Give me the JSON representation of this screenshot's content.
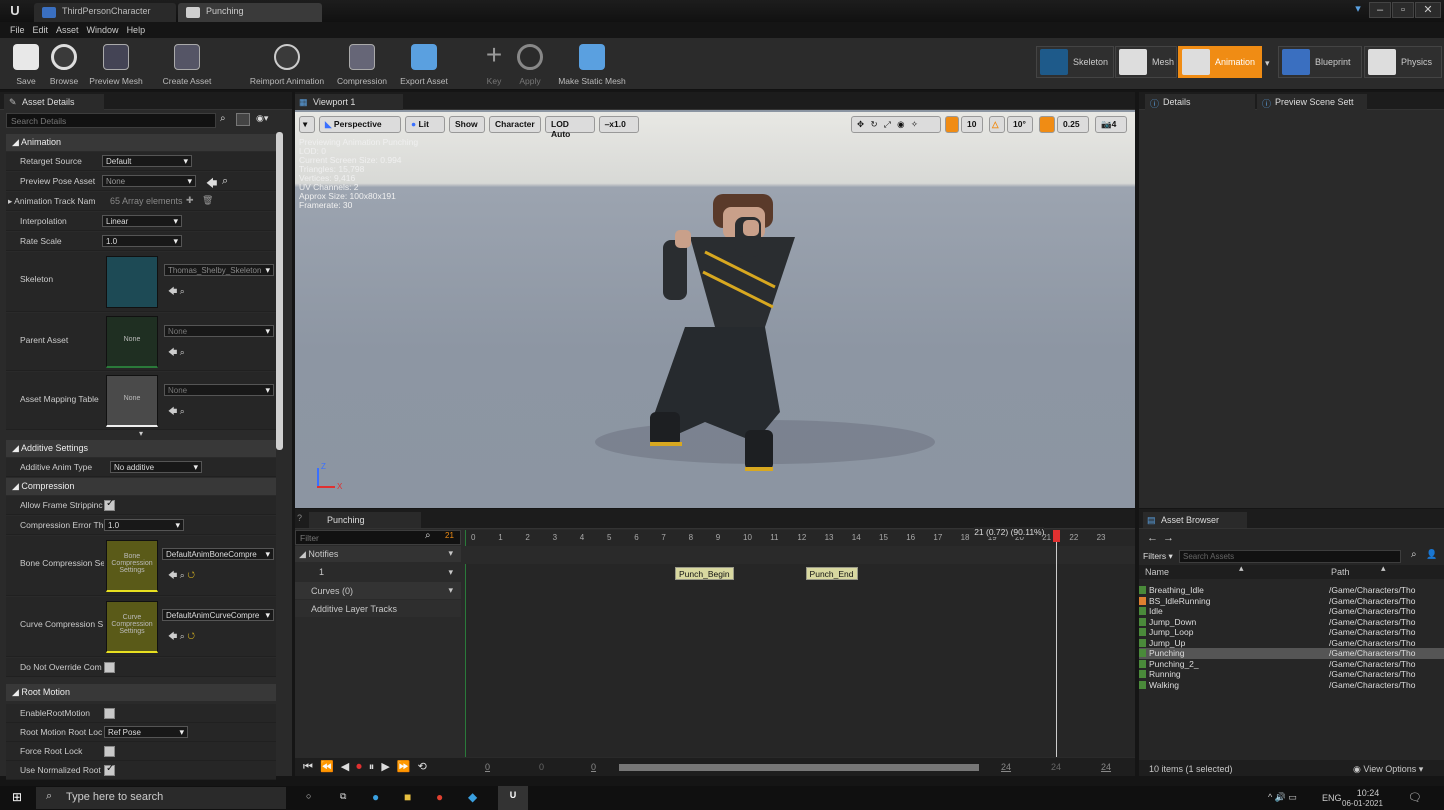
{
  "window": {
    "tabs": [
      "ThirdPersonCharacter",
      "Punching"
    ],
    "controls": [
      "▾",
      "–",
      "▫",
      "✕"
    ]
  },
  "menu": [
    "File",
    "Edit",
    "Asset",
    "Window",
    "Help"
  ],
  "toolbar": {
    "buttons": [
      "Save",
      "Browse",
      "Preview Mesh",
      "Create Asset",
      "Reimport Animation",
      "Compression",
      "Export Asset",
      "Key",
      "Apply",
      "Make Static Mesh"
    ]
  },
  "modes": [
    "Skeleton",
    "Mesh",
    "Animation",
    "Blueprint",
    "Physics"
  ],
  "colors": {
    "accent": "#f08c14",
    "panel": "#2a2a2a"
  },
  "asset_details": {
    "tab": "Asset Details",
    "search_placeholder": "Search Details",
    "categories": [
      "Animation",
      "Additive Settings",
      "Compression",
      "Root Motion"
    ],
    "rows": {
      "retarget_source": {
        "label": "Retarget Source",
        "value": "Default"
      },
      "preview_pose": {
        "label": "Preview Pose Asset",
        "value": "None"
      },
      "track_names": {
        "label": "Animation Track Nam",
        "value": "65 Array elements"
      },
      "interpolation": {
        "label": "Interpolation",
        "value": "Linear"
      },
      "rate_scale": {
        "label": "Rate Scale",
        "value": "1.0"
      },
      "skeleton": {
        "label": "Skeleton",
        "value": "Thomas_Shelby_Skeleton"
      },
      "parent_asset": {
        "label": "Parent Asset",
        "value": "None",
        "thumb": "None"
      },
      "mapping_table": {
        "label": "Asset Mapping Table",
        "value": "None",
        "thumb": "None"
      },
      "additive_type": {
        "label": "Additive Anim Type",
        "value": "No additive"
      },
      "allow_strip": {
        "label": "Allow Frame Strippinc"
      },
      "compression_error": {
        "label": "Compression Error Th",
        "value": "1.0"
      },
      "bone_compression": {
        "label": "Bone Compression Se",
        "value": "DefaultAnimBoneCompre",
        "thumb": "Bone Compression Settings"
      },
      "curve_compression": {
        "label": "Curve Compression S",
        "value": "DefaultAnimCurveCompre",
        "thumb": "Curve Compression Settings"
      },
      "do_not_override": {
        "label": "Do Not Override Com"
      },
      "enable_root": {
        "label": "EnableRootMotion"
      },
      "root_lock": {
        "label": "Root Motion Root Loc",
        "value": "Ref Pose"
      },
      "force_root": {
        "label": "Force Root Lock"
      },
      "normalized_root": {
        "label": "Use Normalized Root"
      }
    }
  },
  "viewport": {
    "tab": "Viewport 1",
    "buttons": [
      "Perspective",
      "Lit",
      "Show",
      "Character",
      "LOD Auto",
      "x1.0"
    ],
    "right_values": [
      "10",
      "10°",
      "0.25",
      "4"
    ],
    "stats": [
      "Previewing Animation Punching",
      "LOD: 0",
      "Current Screen Size: 0.994",
      "Triangles: 15,798",
      "Vertices: 9,416",
      "UV Channels: 2",
      "Approx Size: 100x80x191",
      "Framerate: 30"
    ],
    "axis_labels": [
      "Z",
      "X"
    ]
  },
  "timeline": {
    "tab": "Punching",
    "filter_placeholder": "Filter",
    "frame_badge": "21",
    "tracks": [
      "Notifies",
      "1",
      "Curves (0)",
      "Additive Layer Tracks"
    ],
    "ticks": [
      "0",
      "1",
      "2",
      "3",
      "4",
      "5",
      "6",
      "7",
      "8",
      "9",
      "10",
      "11",
      "12",
      "13",
      "14",
      "15",
      "16",
      "17",
      "18",
      "19",
      "20",
      "21",
      "22",
      "23"
    ],
    "playhead_label": "21 (0.72) (90.11%)",
    "playhead_frame": 21,
    "notifies": [
      {
        "name": "Punch_Begin",
        "frame": 7.5
      },
      {
        "name": "Punch_End",
        "frame": 12.3
      }
    ],
    "bottom": [
      "0",
      "0",
      "0",
      "24",
      "24",
      "24"
    ]
  },
  "details": {
    "tabs": [
      "Details",
      "Preview Scene Sett"
    ]
  },
  "asset_browser": {
    "tab": "Asset Browser",
    "filters": "Filters",
    "search_placeholder": "Search Assets",
    "columns": [
      "Name",
      "Path"
    ],
    "items": [
      {
        "name": "Breathing_Idle",
        "path": "/Game/Characters/Tho"
      },
      {
        "name": "BS_IdleRunning",
        "path": "/Game/Characters/Tho"
      },
      {
        "name": "Idle",
        "path": "/Game/Characters/Tho"
      },
      {
        "name": "Jump_Down",
        "path": "/Game/Characters/Tho"
      },
      {
        "name": "Jump_Loop",
        "path": "/Game/Characters/Tho"
      },
      {
        "name": "Jump_Up",
        "path": "/Game/Characters/Tho"
      },
      {
        "name": "Punching",
        "path": "/Game/Characters/Tho"
      },
      {
        "name": "Punching_2_",
        "path": "/Game/Characters/Tho"
      },
      {
        "name": "Running",
        "path": "/Game/Characters/Tho"
      },
      {
        "name": "Walking",
        "path": "/Game/Characters/Tho"
      }
    ],
    "selected_index": 6,
    "status": "10 items (1 selected)",
    "view_options": "View Options"
  },
  "taskbar": {
    "search": "Type here to search",
    "lang": "ENG",
    "time": "10:24",
    "date": "06-01-2021"
  }
}
